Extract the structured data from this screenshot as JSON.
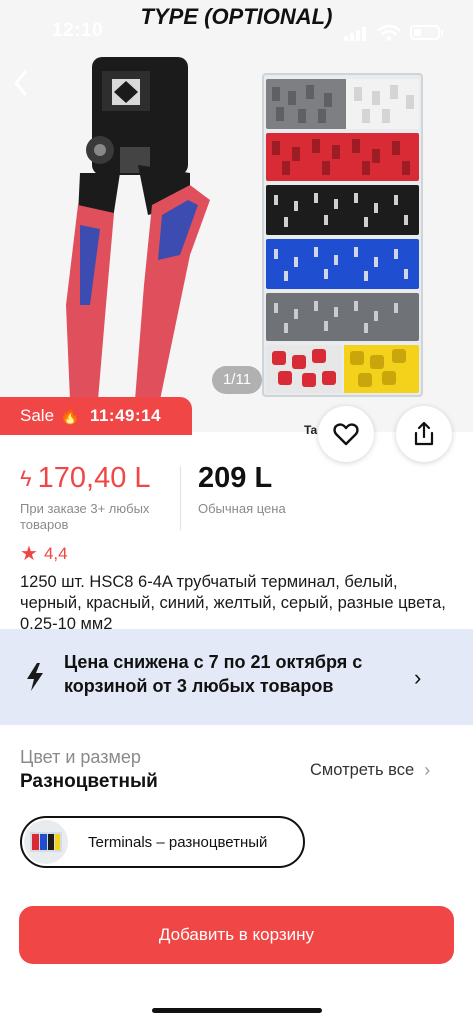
{
  "status_bar": {
    "time": "12:10"
  },
  "overlay_title": "TYPE (OPTIONAL)",
  "gallery": {
    "counter": "1/11",
    "brand_text": "Ta"
  },
  "sale": {
    "label": "Sale",
    "timer": "11:49:14"
  },
  "price": {
    "sale_price": "170,40 L",
    "sale_note": "При заказе 3+ любых товаров",
    "regular_price": "209 L",
    "regular_note": "Обычная цена"
  },
  "rating": "4,4",
  "product_title": "1250 шт. HSC8 6-4A трубчатый терминал, белый, черный, красный, синий, желтый, серый, разные цвета, 0,25-10 мм2",
  "promo": {
    "text": "Цена снижена с 7 по 21 октября с корзиной от 3 любых товаров"
  },
  "options": {
    "label": "Цвет и размер",
    "selected": "Разноцветный",
    "see_all": "Смотреть все",
    "variant_label": "Terminals – разноцветный"
  },
  "cart_button": "Добавить в корзину",
  "colors": {
    "accent": "#f04645",
    "promo_bg": "#e3e9f6",
    "muted_text": "#8a8a8a"
  },
  "icons": {
    "back": "chevron-left-icon",
    "favorite": "heart-icon",
    "share": "share-icon",
    "promo": "lightning-icon",
    "fire": "fire-icon",
    "star": "star-icon"
  }
}
